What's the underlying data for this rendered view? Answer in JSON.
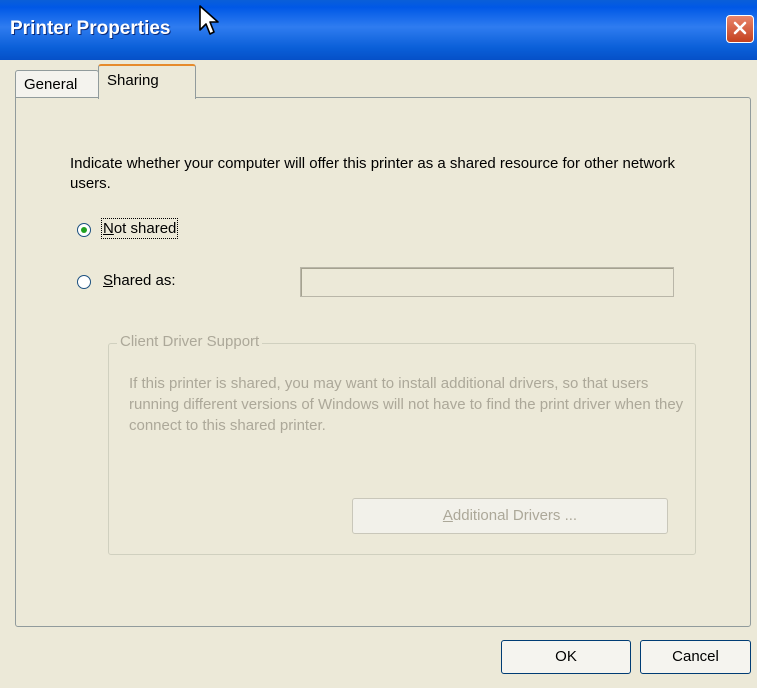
{
  "window": {
    "title": "Printer Properties",
    "close_icon": "close-icon"
  },
  "tabs": [
    {
      "label": "General",
      "selected": false
    },
    {
      "label": "Sharing",
      "selected": true
    }
  ],
  "sharing": {
    "intro": "Indicate whether your computer will offer this printer as a shared resource for other network users.",
    "not_shared": {
      "prefix": "",
      "accel": "N",
      "rest": "ot shared",
      "selected": true
    },
    "shared_as": {
      "prefix": "",
      "accel": "S",
      "rest": "hared as:",
      "selected": false
    },
    "share_name_value": ""
  },
  "client_driver_support": {
    "legend": "Client Driver Support",
    "description": "If this printer is shared, you may want to install additional drivers, so that users running different versions of Windows will not have to find the print driver when they connect to this shared printer.",
    "additional_drivers": {
      "accel": "A",
      "rest": "dditional Drivers ..."
    }
  },
  "buttons": {
    "ok": "OK",
    "cancel": "Cancel"
  },
  "colors": {
    "titlebar": "#0a5fd8",
    "dialog_bg": "#ece9d8",
    "selected_tab_accent": "#e68b2c",
    "disabled_text": "#aca899"
  }
}
